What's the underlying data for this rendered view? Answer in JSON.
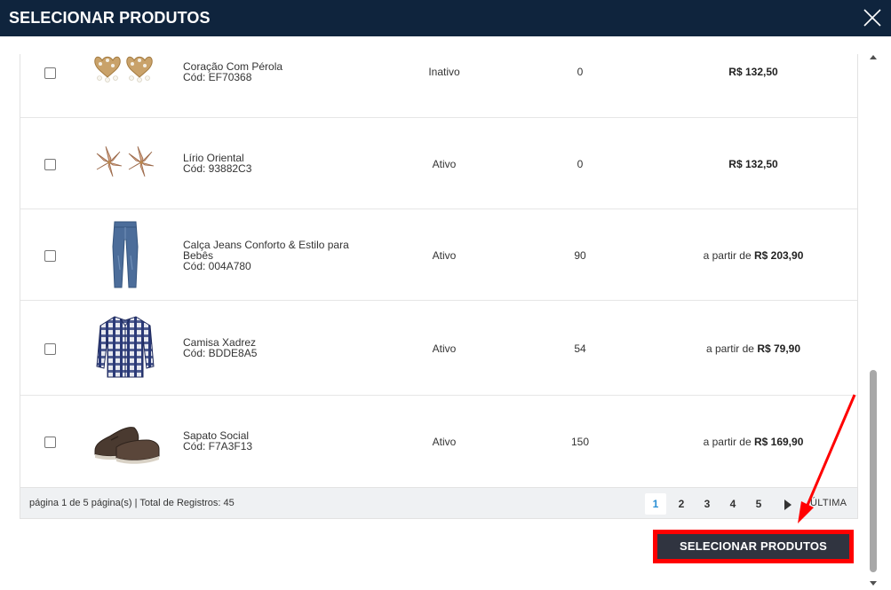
{
  "modal": {
    "title": "SELECIONAR PRODUTOS"
  },
  "products": [
    {
      "name": "Coração Com Pérola",
      "code": "Cód: EF70368",
      "status": "Inativo",
      "stock": "0",
      "price_prefix": "",
      "price": "R$ 132,50",
      "image": "earrings-heart-pearl"
    },
    {
      "name": "Lírio Oriental",
      "code": "Cód: 93882C3",
      "status": "Ativo",
      "stock": "0",
      "price_prefix": "",
      "price": "R$ 132,50",
      "image": "earrings-lily"
    },
    {
      "name": "Calça Jeans Conforto & Estilo para Bebês",
      "code": "Cód: 004A780",
      "status": "Ativo",
      "stock": "90",
      "price_prefix": "a partir de ",
      "price": "R$ 203,90",
      "image": "jeans"
    },
    {
      "name": "Camisa Xadrez",
      "code": "Cód: BDDE8A5",
      "status": "Ativo",
      "stock": "54",
      "price_prefix": "a partir de ",
      "price": "R$ 79,90",
      "image": "plaid-shirt"
    },
    {
      "name": "Sapato Social",
      "code": "Cód: F7A3F13",
      "status": "Ativo",
      "stock": "150",
      "price_prefix": "a partir de ",
      "price": "R$ 169,90",
      "image": "dress-shoes"
    }
  ],
  "pagination": {
    "info": "página 1 de 5 página(s) | Total de Registros: 45",
    "pages": [
      "1",
      "2",
      "3",
      "4",
      "5"
    ],
    "current": "1",
    "last_label": "ÚLTIMA"
  },
  "submit": {
    "label": "SELECIONAR PRODUTOS"
  },
  "colors": {
    "header_bg": "#0f243d",
    "button_bg": "#303440",
    "highlight": "#ff0000",
    "active_page": "#2a8fd4"
  }
}
